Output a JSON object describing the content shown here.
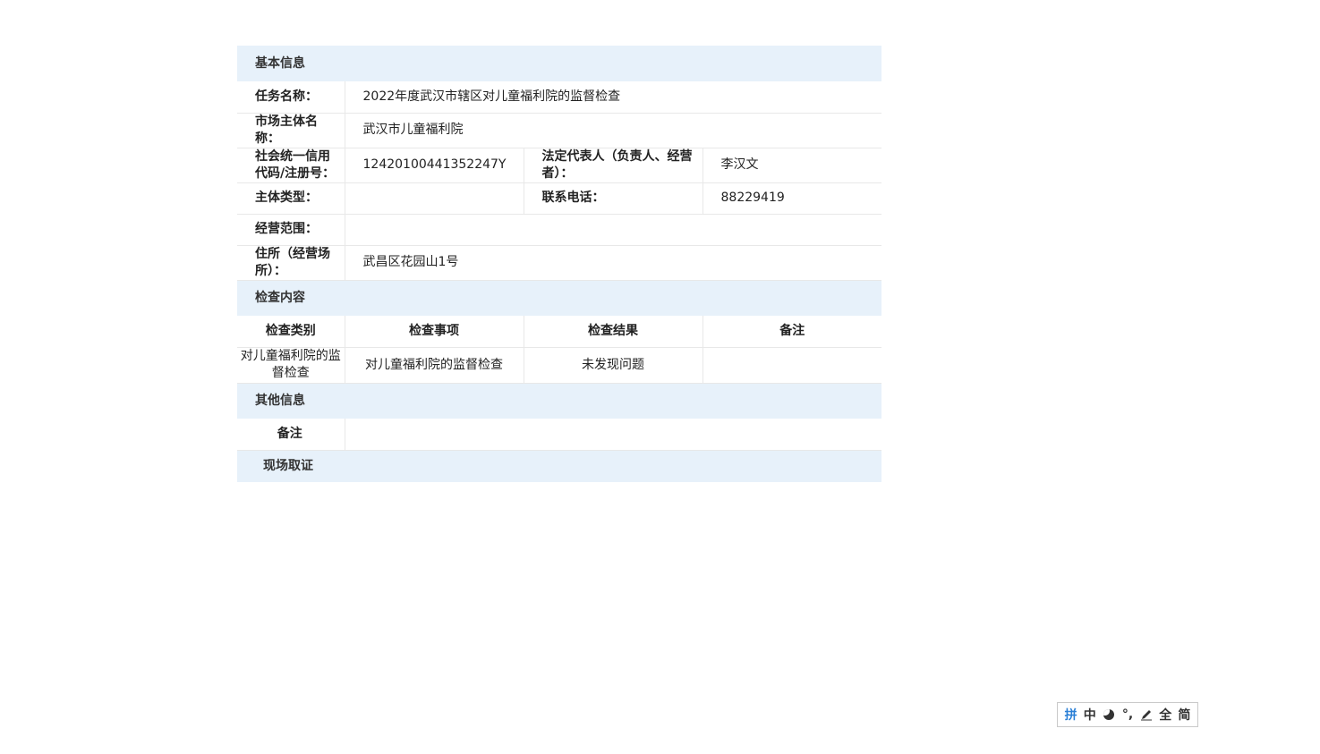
{
  "basic": {
    "section_title": "基本信息",
    "task_label": "任务名称：",
    "task_value": "2022年度武汉市辖区对儿童福利院的监督检查",
    "entity_label": "市场主体名称：",
    "entity_value": "武汉市儿童福利院",
    "credit_label": "社会统一信用代码/注册号：",
    "credit_value": "12420100441352247Y",
    "legal_label": "法定代表人（负责人、经营者）：",
    "legal_value": "李汉文",
    "type_label": "主体类型：",
    "type_value": "",
    "phone_label": "联系电话：",
    "phone_value": "88229419",
    "scope_label": "经营范围：",
    "scope_value": "",
    "address_label": "住所（经营场所）：",
    "address_value": "武昌区花园山1号"
  },
  "inspection": {
    "section_title": "检查内容",
    "headers": [
      "检查类别",
      "检查事项",
      "检查结果",
      "备注"
    ],
    "rows": [
      {
        "category": "对儿童福利院的监督检查",
        "item": "对儿童福利院的监督检查",
        "result": "未发现问题",
        "remark": ""
      }
    ]
  },
  "other": {
    "section_title": "其他信息",
    "remark_label": "备注",
    "remark_value": ""
  },
  "evidence": {
    "section_title": "现场取证"
  },
  "ime_toolbar": {
    "pinyin": "拼",
    "zh": "中",
    "punct": "°,",
    "full": "全",
    "simplified": "简"
  }
}
